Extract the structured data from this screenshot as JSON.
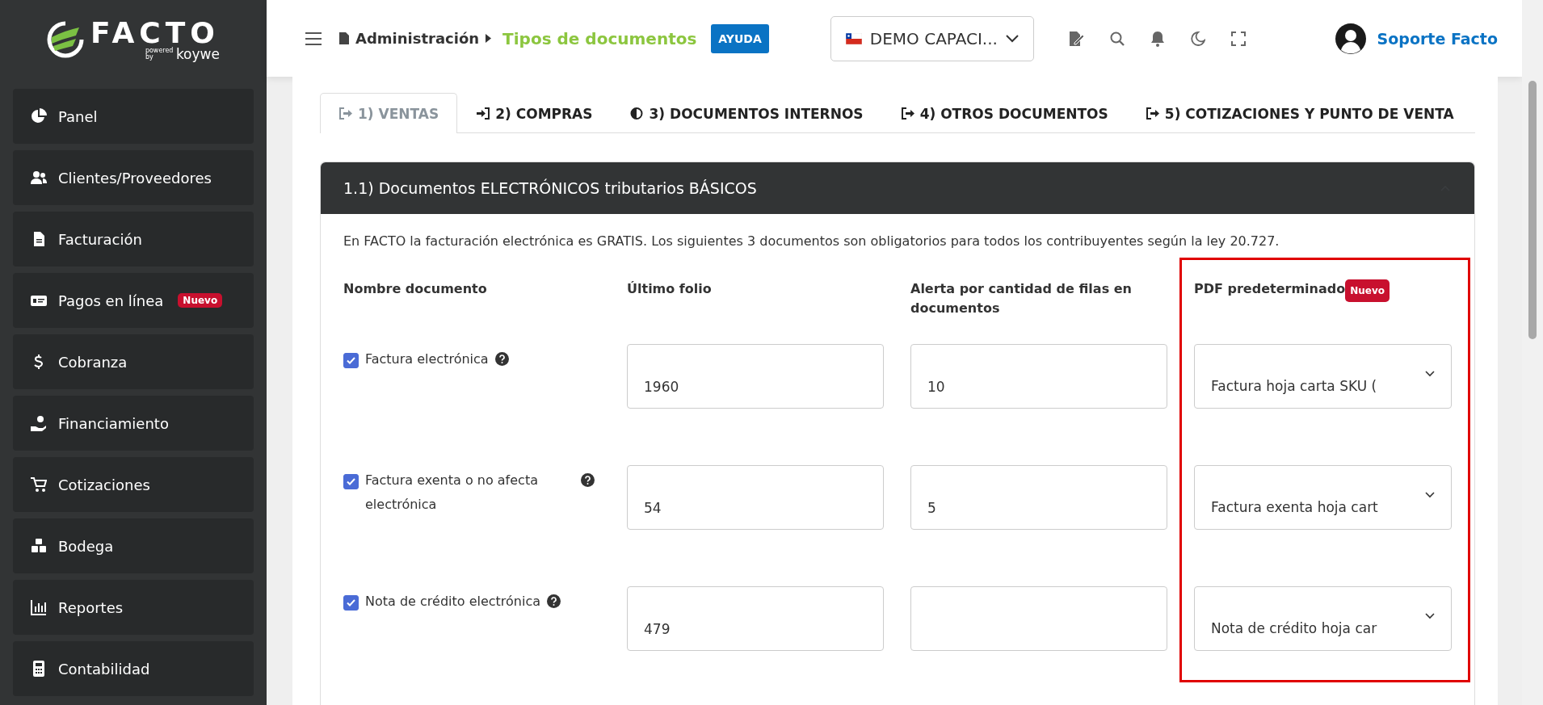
{
  "sidebar": {
    "logo": {
      "name": "FACTO",
      "tagline": "powered by",
      "brand": "koywe"
    },
    "items": [
      {
        "label": "Panel"
      },
      {
        "label": "Clientes/Proveedores"
      },
      {
        "label": "Facturación"
      },
      {
        "label": "Pagos en línea",
        "badge": "Nuevo"
      },
      {
        "label": "Cobranza"
      },
      {
        "label": "Financiamiento"
      },
      {
        "label": "Cotizaciones"
      },
      {
        "label": "Bodega"
      },
      {
        "label": "Reportes"
      },
      {
        "label": "Contabilidad"
      }
    ]
  },
  "header": {
    "breadcrumb": [
      "Administración",
      "Tipos de documentos"
    ],
    "help_button": "AYUDA",
    "company_select": "DEMO CAPACI...",
    "user_name": "Soporte Facto"
  },
  "tabs": [
    {
      "label": "1) VENTAS",
      "selected": true
    },
    {
      "label": "2) COMPRAS",
      "selected": false
    },
    {
      "label": "3) DOCUMENTOS INTERNOS",
      "selected": false
    },
    {
      "label": "4) OTROS DOCUMENTOS",
      "selected": false
    },
    {
      "label": "5) COTIZACIONES Y PUNTO DE VENTA",
      "selected": false
    }
  ],
  "section": {
    "title": "1.1) Documentos ELECTRÓNICOS tributarios BÁSICOS",
    "description": "En FACTO la facturación electrónica es GRATIS. Los siguientes 3 documentos son obligatorios para todos los contribuyentes según la ley 20.727.",
    "columns": [
      {
        "label": "Nombre documento"
      },
      {
        "label": "Último folio"
      },
      {
        "label": "Alerta por cantidad de filas en documentos"
      },
      {
        "label": "PDF predeterminado",
        "badge": "Nuevo"
      }
    ],
    "rows": [
      {
        "name": "Factura electrónica",
        "checked": true,
        "folio": "1960",
        "alert": "10",
        "pdf": "Factura hoja carta SKU ("
      },
      {
        "name": "Factura exenta o no afecta electrónica",
        "checked": true,
        "folio": "54",
        "alert": "5",
        "pdf": "Factura exenta hoja cart"
      },
      {
        "name": "Nota de crédito electrónica",
        "checked": true,
        "folio": "479",
        "pdf": "Nota de crédito hoja car"
      }
    ]
  }
}
